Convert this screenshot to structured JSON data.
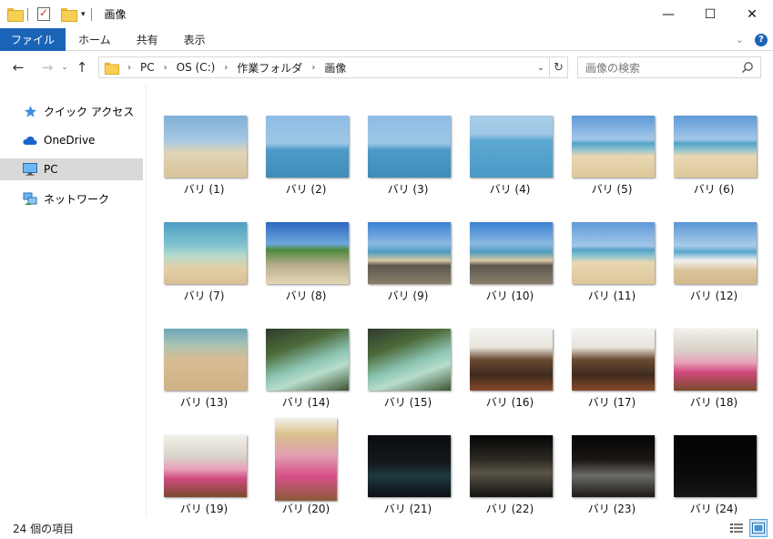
{
  "window": {
    "title": "画像",
    "minimize": "—",
    "maximize": "☐",
    "close": "✕"
  },
  "ribbon": {
    "tabs": [
      "ファイル",
      "ホーム",
      "共有",
      "表示"
    ],
    "expand": "⌄",
    "help": "?"
  },
  "nav": {
    "back": "←",
    "forward": "→",
    "recent": "⌄",
    "up": "↑",
    "breadcrumb": [
      "PC",
      "OS (C:)",
      "作業フォルダ",
      "画像"
    ],
    "crumb_sep": "›",
    "dropdown": "⌄",
    "refresh": "↻",
    "search_placeholder": "画像の検索"
  },
  "sidebar": {
    "items": [
      {
        "label": "クイック アクセス",
        "icon": "star-icon"
      },
      {
        "label": "OneDrive",
        "icon": "cloud-icon"
      },
      {
        "label": "PC",
        "icon": "monitor-icon",
        "selected": true
      },
      {
        "label": "ネットワーク",
        "icon": "network-icon"
      }
    ]
  },
  "files": [
    {
      "name": "バリ (1)",
      "scene": "beach-trees"
    },
    {
      "name": "バリ (2)",
      "scene": "sea-island"
    },
    {
      "name": "バリ (3)",
      "scene": "sea-island"
    },
    {
      "name": "バリ (4)",
      "scene": "sea-people"
    },
    {
      "name": "バリ (5)",
      "scene": "shore"
    },
    {
      "name": "バリ (6)",
      "scene": "shore"
    },
    {
      "name": "バリ (7)",
      "scene": "shallow"
    },
    {
      "name": "バリ (8)",
      "scene": "beach-people"
    },
    {
      "name": "バリ (9)",
      "scene": "rocks"
    },
    {
      "name": "バリ (10)",
      "scene": "rocks"
    },
    {
      "name": "バリ (11)",
      "scene": "shore"
    },
    {
      "name": "バリ (12)",
      "scene": "waves"
    },
    {
      "name": "バリ (13)",
      "scene": "wet-sand"
    },
    {
      "name": "バリ (14)",
      "scene": "pool-garden"
    },
    {
      "name": "バリ (15)",
      "scene": "pool-garden"
    },
    {
      "name": "バリ (16)",
      "scene": "pavilion"
    },
    {
      "name": "バリ (17)",
      "scene": "pavilion"
    },
    {
      "name": "バリ (18)",
      "scene": "dancers"
    },
    {
      "name": "バリ (19)",
      "scene": "dancers"
    },
    {
      "name": "バリ (20)",
      "scene": "dancers-portrait",
      "portrait": true
    },
    {
      "name": "バリ (21)",
      "scene": "night-pool"
    },
    {
      "name": "バリ (22)",
      "scene": "night-wall"
    },
    {
      "name": "バリ (23)",
      "scene": "night-path"
    },
    {
      "name": "バリ (24)",
      "scene": "night-dark"
    }
  ],
  "status": {
    "count_text": "24 個の項目"
  }
}
